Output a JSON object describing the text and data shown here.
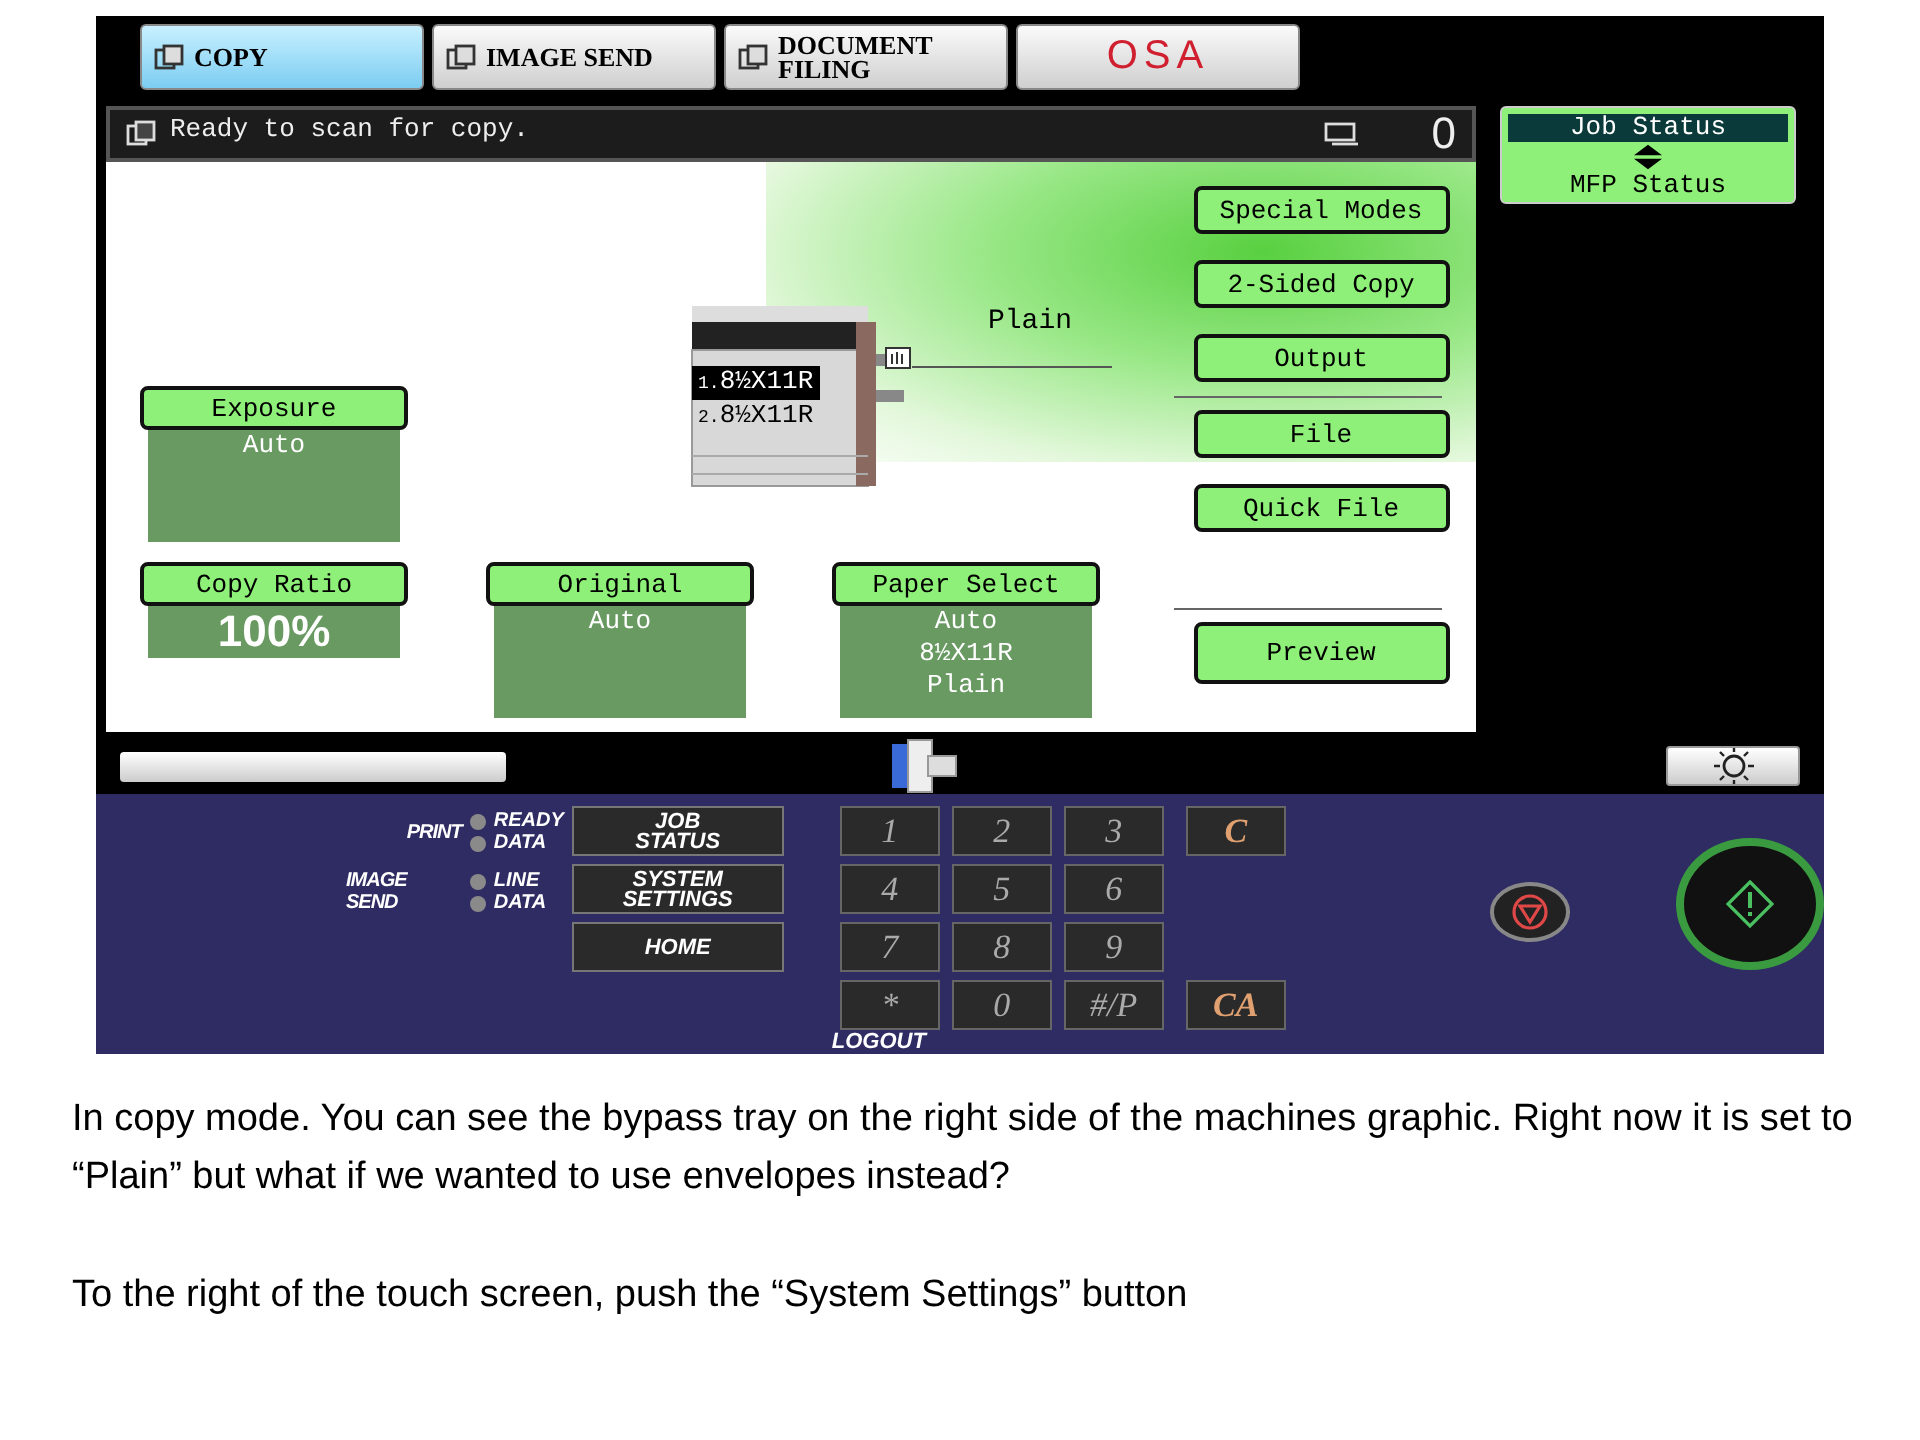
{
  "tabs": [
    {
      "kind": "text",
      "label": "COPY",
      "selected": true
    },
    {
      "kind": "text",
      "label": "IMAGE SEND",
      "selected": false
    },
    {
      "kind": "text",
      "label": "DOCUMENT FILING",
      "selected": false
    },
    {
      "kind": "logo",
      "label": "OSA",
      "selected": false
    }
  ],
  "status_bar": {
    "message": "Ready to scan for copy.",
    "count": "0"
  },
  "job_status_button": {
    "top": "Job Status",
    "bottom": "MFP Status"
  },
  "trays": [
    {
      "number": "1.",
      "size": "8½X11R",
      "selected": true
    },
    {
      "number": "2.",
      "size": "8½X11R",
      "selected": false
    }
  ],
  "bypass_tray": {
    "label": "Plain"
  },
  "settings": [
    {
      "kind": "text",
      "title": "Exposure",
      "lines": [
        "Auto"
      ]
    },
    {
      "kind": "big",
      "title": "Copy Ratio",
      "lines": [
        "100%"
      ]
    },
    {
      "kind": "text",
      "title": "Original",
      "lines": [
        "Auto"
      ]
    },
    {
      "kind": "text",
      "title": "Paper Select",
      "lines": [
        "Auto",
        "8½X11R",
        "Plain"
      ]
    }
  ],
  "side_buttons": [
    [
      "Special Modes",
      "2-Sided Copy",
      "Output"
    ],
    [
      "File",
      "Quick File"
    ],
    [
      "Preview"
    ]
  ],
  "indicators": [
    {
      "group": "PRINT",
      "leds": [
        "READY",
        "DATA"
      ]
    },
    {
      "group": "IMAGE SEND",
      "leds": [
        "LINE",
        "DATA"
      ]
    }
  ],
  "function_keys": [
    "JOB STATUS",
    "SYSTEM SETTINGS",
    "HOME"
  ],
  "keypad": [
    [
      {
        "kind": "digit",
        "label": "1"
      },
      {
        "kind": "digit",
        "label": "2"
      },
      {
        "kind": "digit",
        "label": "3"
      },
      {
        "kind": "clear",
        "label": "C"
      }
    ],
    [
      {
        "kind": "digit",
        "label": "4"
      },
      {
        "kind": "digit",
        "label": "5"
      },
      {
        "kind": "digit",
        "label": "6"
      }
    ],
    [
      {
        "kind": "digit",
        "label": "7"
      },
      {
        "kind": "digit",
        "label": "8"
      },
      {
        "kind": "digit",
        "label": "9"
      }
    ],
    [
      {
        "kind": "digit",
        "label": "*"
      },
      {
        "kind": "digit",
        "label": "0"
      },
      {
        "kind": "digit",
        "label": "#/P"
      },
      {
        "kind": "clear",
        "label": "CA"
      }
    ]
  ],
  "logout_label": "LOGOUT",
  "caption": [
    "In copy mode. You can see the bypass tray on the right side of the machines graphic. Right now it is set to “Plain” but what if we wanted to use envelopes instead?",
    "To the right of the touch screen, push the “System Settings” button"
  ]
}
